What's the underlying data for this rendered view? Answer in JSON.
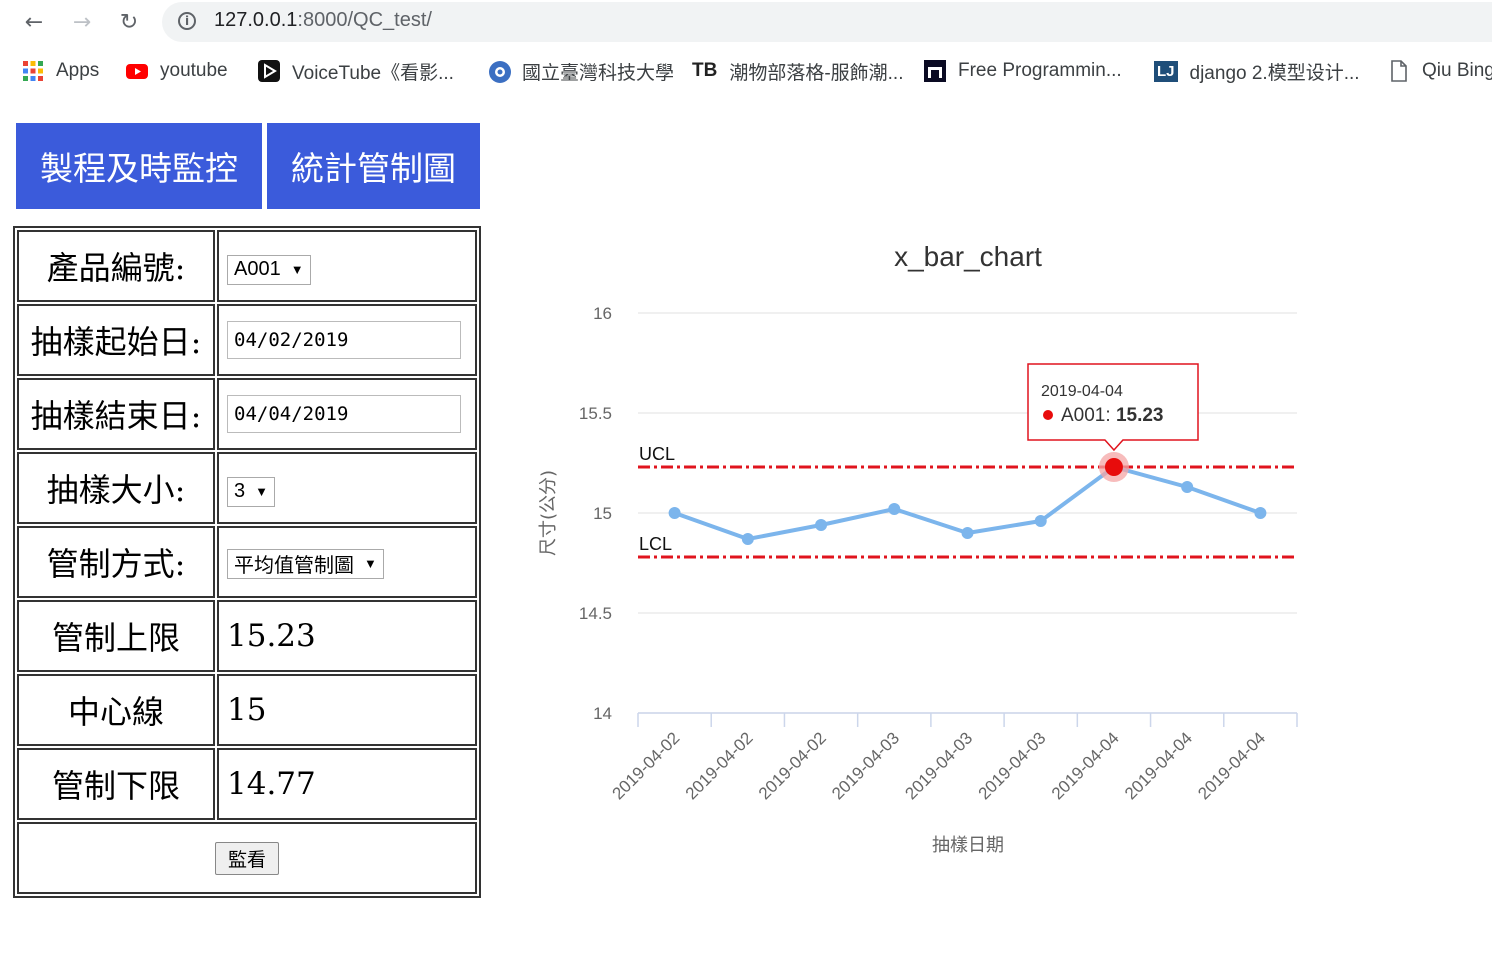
{
  "browser": {
    "url_host": "127.0.0.1",
    "url_rest": ":8000/QC_test/",
    "bookmarks": [
      {
        "label": "Apps",
        "icon": "apps-grid-icon"
      },
      {
        "label": "youtube",
        "icon": "youtube-icon"
      },
      {
        "label": "VoiceTube《看影...",
        "icon": "voicetube-icon"
      },
      {
        "label": "國立臺灣科技大學",
        "icon": "ntust-icon"
      },
      {
        "label": "潮物部落格-服飾潮...",
        "icon": "tb-icon",
        "prefix": "TB"
      },
      {
        "label": "Free Programmin...",
        "icon": "freecodecamp-icon"
      },
      {
        "label": "django 2.模型设计...",
        "icon": "lj-icon",
        "prefix": "LJ"
      },
      {
        "label": "Qiu Bing",
        "icon": "page-icon"
      }
    ]
  },
  "nav": {
    "btn1": "製程及時監控",
    "btn2": "統計管制圖"
  },
  "form": {
    "product_label": "產品編號:",
    "product_value": "A001",
    "start_label": "抽樣起始日:",
    "start_value": "04/02/2019",
    "end_label": "抽樣結束日:",
    "end_value": "04/04/2019",
    "size_label": "抽樣大小:",
    "size_value": "3",
    "method_label": "管制方式:",
    "method_value": "平均值管制圖",
    "ucl_label": "管制上限",
    "ucl_value": "15.23",
    "cl_label": "中心線",
    "cl_value": "15",
    "lcl_label": "管制下限",
    "lcl_value": "14.77",
    "submit_label": "監看"
  },
  "chart_data": {
    "type": "line",
    "title": "x_bar_chart",
    "xlabel": "抽樣日期",
    "ylabel": "尺寸(公分)",
    "categories": [
      "2019-04-02",
      "2019-04-02",
      "2019-04-02",
      "2019-04-03",
      "2019-04-03",
      "2019-04-03",
      "2019-04-04",
      "2019-04-04",
      "2019-04-04"
    ],
    "series": [
      {
        "name": "A001",
        "values": [
          15.0,
          14.87,
          14.94,
          15.02,
          14.9,
          14.96,
          15.23,
          15.13,
          15.0
        ],
        "color": "#7cb5ec"
      }
    ],
    "ylim": [
      14,
      16
    ],
    "yticks": [
      "14",
      "14.5",
      "15",
      "15.5",
      "16"
    ],
    "plot_lines": [
      {
        "label": "UCL",
        "value": 15.23,
        "color": "#e0141e"
      },
      {
        "label": "LCL",
        "value": 14.78,
        "color": "#e0141e"
      }
    ],
    "tooltip": {
      "index": 6,
      "header": "2019-04-04",
      "series": "A001",
      "value": "15.23"
    },
    "grid": true
  }
}
